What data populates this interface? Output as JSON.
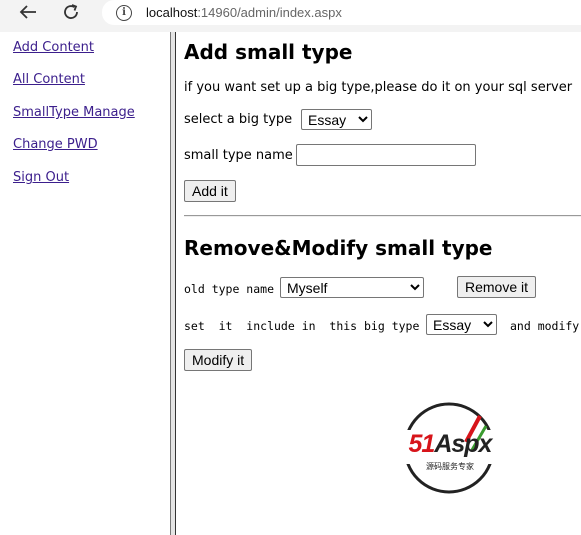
{
  "browser": {
    "url_host": "localhost",
    "url_path": ":14960/admin/index.aspx"
  },
  "sidebar": {
    "items": [
      {
        "label": "Add Content"
      },
      {
        "label": "All Content"
      },
      {
        "label": "SmallType Manage"
      },
      {
        "label": "Change PWD"
      },
      {
        "label": "Sign Out"
      }
    ]
  },
  "add_section": {
    "title": "Add small type",
    "hint": "if you want set up a big type,please do it on your sql server",
    "big_type_label": "select a big type",
    "big_type_value": "Essay",
    "small_type_label": "small type name",
    "small_type_value": "",
    "add_button": "Add it"
  },
  "modify_section": {
    "title": "Remove&Modify small type",
    "old_type_label": "old type name",
    "old_type_value": "Myself",
    "remove_button": "Remove it",
    "set_label": "set  it  include in  this big type",
    "set_value": "Essay",
    "and_modify_label": "and modify",
    "modify_button": "Modify it"
  },
  "logo": {
    "brand_number": "51",
    "brand_text": "Aspx",
    "tagline": "源码服务专家",
    "colors": {
      "red": "#d7141a",
      "green": "#3a9b2f",
      "dark": "#222222"
    }
  }
}
